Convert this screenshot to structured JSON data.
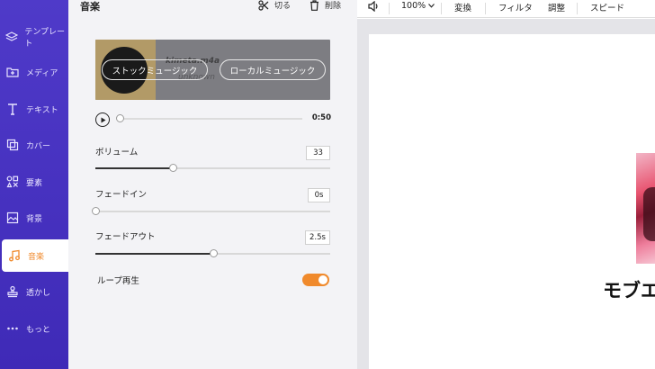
{
  "sidebar": {
    "items": [
      {
        "label": "テンプレート",
        "icon": "layers-icon"
      },
      {
        "label": "メディア",
        "icon": "folder-plus-icon"
      },
      {
        "label": "テキスト",
        "icon": "text-icon"
      },
      {
        "label": "カバー",
        "icon": "copy-icon"
      },
      {
        "label": "要素",
        "icon": "shapes-icon"
      },
      {
        "label": "背景",
        "icon": "background-icon"
      },
      {
        "label": "音楽",
        "icon": "music-note-icon",
        "active": true
      },
      {
        "label": "透かし",
        "icon": "stamp-icon"
      },
      {
        "label": "もっと",
        "icon": "more-dots-icon"
      }
    ]
  },
  "panel": {
    "title": "音楽",
    "cut_label": "切る",
    "delete_label": "削除",
    "track": {
      "name": "kimeta.m4a",
      "artist": "unknown"
    },
    "stock_music_label": "ストックミュージック",
    "local_music_label": "ローカルミュージック",
    "duration": "0:50",
    "playback_progress": 0,
    "volume": {
      "label": "ボリューム",
      "value": "33",
      "level": 0.33
    },
    "fade_in": {
      "label": "フェードイン",
      "value": "0s",
      "level": 0
    },
    "fade_out": {
      "label": "フェードアウト",
      "value": "2.5s",
      "level": 0.5
    },
    "loop": {
      "label": "ループ再生",
      "enabled": true
    }
  },
  "toolbar": {
    "zoom": "100%",
    "convert_label": "変換",
    "filter_label": "フィルタ",
    "adjust_label": "調整",
    "speed_label": "スピード"
  },
  "canvas": {
    "visible_text": "モブエ"
  },
  "colors": {
    "accent": "#f08a2c",
    "nav_bg": "#4f3ac9",
    "canvas_bg": "#e4e4e8"
  }
}
